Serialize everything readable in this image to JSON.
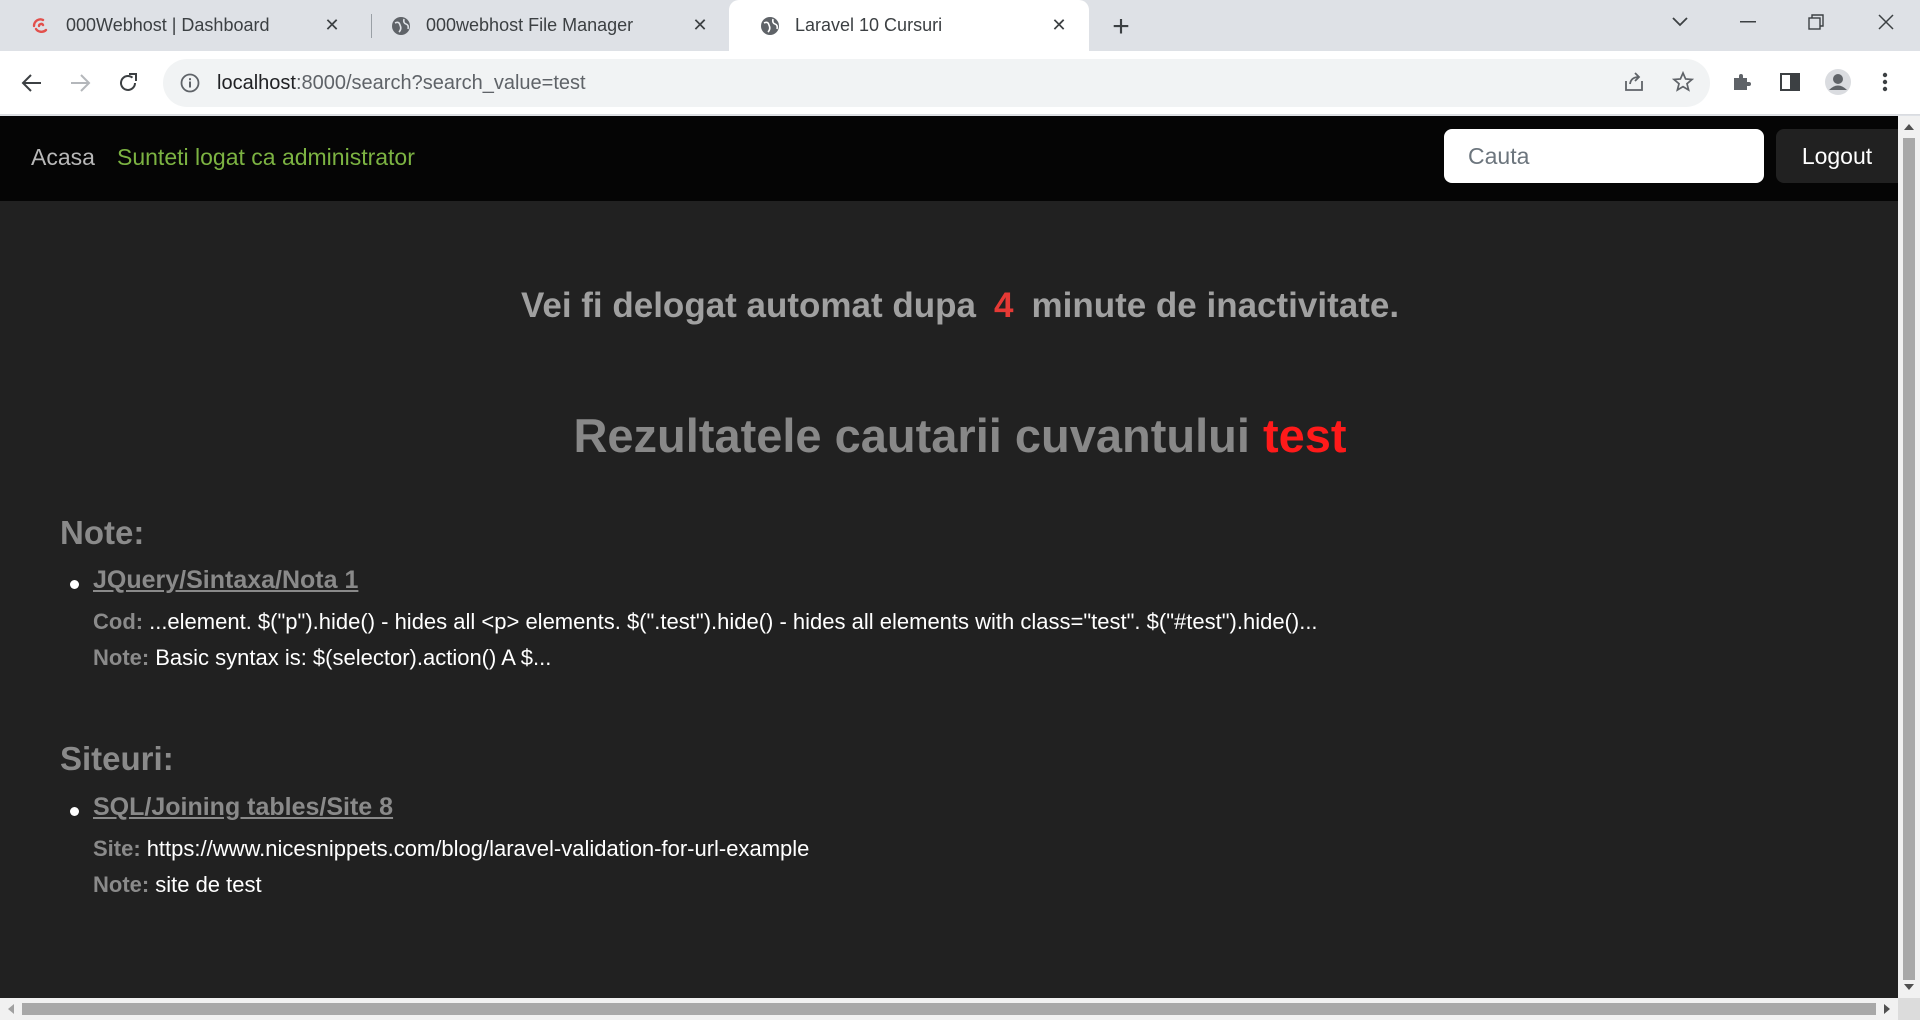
{
  "browser": {
    "tabs": [
      {
        "title": "000Webhost | Dashboard",
        "icon": "webhost-logo-icon",
        "active": false
      },
      {
        "title": "000webhost File Manager",
        "icon": "globe-icon",
        "active": false
      },
      {
        "title": "Laravel 10 Cursuri",
        "icon": "globe-icon",
        "active": true
      }
    ],
    "url_host": "localhost",
    "url_rest": ":8000/search?search_value=test"
  },
  "nav": {
    "home_label": "Acasa",
    "status_label": "Sunteti logat ca administrator",
    "search_placeholder": "Cauta",
    "logout_label": "Logout"
  },
  "main": {
    "timeout_prefix": "Vei fi delogat automat dupa",
    "timeout_minutes": "4",
    "timeout_suffix": "minute de inactivitate.",
    "results_prefix": "Rezultatele cautarii cuvantului",
    "search_term": "test"
  },
  "notes": {
    "heading": "Note:",
    "items": [
      {
        "link": "JQuery/Sintaxa/Nota 1",
        "code_label": "Cod:",
        "code": "...element. $(\"p\").hide() - hides all <p> elements. $(\".test\").hide() - hides all elements with class=\"test\". $(\"#test\").hide()...",
        "note_label": "Note:",
        "note": "Basic syntax is: $(selector).action() A $..."
      }
    ]
  },
  "sites": {
    "heading": "Siteuri:",
    "items": [
      {
        "link": "SQL/Joining tables/Site 8",
        "site_label": "Site:",
        "site": "https://www.nicesnippets.com/blog/laravel-validation-for-url-example",
        "note_label": "Note:",
        "note": "site de test"
      }
    ]
  },
  "colors": {
    "nav_bg": "#050505",
    "page_bg": "#212121",
    "accent_red": "#ff1a1a",
    "status_green": "#7cb342"
  }
}
